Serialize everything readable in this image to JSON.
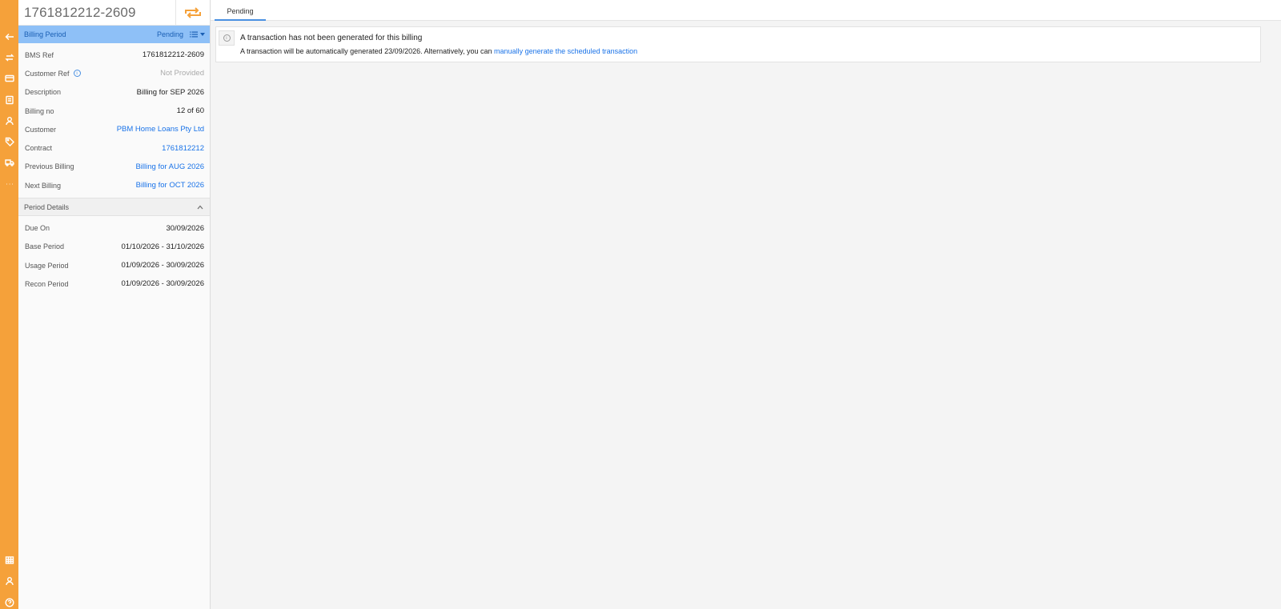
{
  "rail": {
    "top_icons": [
      "back-arrow-icon",
      "swap-icon",
      "card-icon",
      "document-icon",
      "user-icon",
      "tag-icon",
      "truck-icon",
      "more-icon"
    ],
    "bottom_icons": [
      "grid-icon",
      "account-icon",
      "help-icon"
    ]
  },
  "panel": {
    "title": "1761812212-2609",
    "period_bar": {
      "label": "Billing Period",
      "status": "Pending"
    },
    "fields": [
      {
        "label": "BMS Ref",
        "value": "1761812212-2609"
      },
      {
        "label": "Customer Ref",
        "value": "Not Provided"
      },
      {
        "label": "Description",
        "value": "Billing for SEP 2026"
      },
      {
        "label": "Billing no",
        "value": "12 of 60"
      },
      {
        "label": "Customer",
        "value": "PBM Home Loans Pty Ltd"
      },
      {
        "label": "Contract",
        "value": "1761812212"
      },
      {
        "label": "Previous Billing",
        "value": "Billing for AUG 2026"
      },
      {
        "label": "Next Billing",
        "value": "Billing for OCT 2026"
      }
    ],
    "period_details": {
      "label": "Period Details",
      "fields": [
        {
          "label": "Due On",
          "value": "30/09/2026"
        },
        {
          "label": "Base Period",
          "value": "01/10/2026 - 31/10/2026"
        },
        {
          "label": "Usage Period",
          "value": "01/09/2026 - 30/09/2026"
        },
        {
          "label": "Recon Period",
          "value": "01/09/2026 - 30/09/2026"
        }
      ]
    }
  },
  "main": {
    "tabs": [
      {
        "label": "Pending"
      }
    ],
    "notice": {
      "title": "A transaction has not been generated for this billing",
      "body": "A transaction will be automatically generated 23/09/2026. Alternatively, you can",
      "link": "manually generate the scheduled transaction"
    }
  },
  "colors": {
    "rail": "#f5a13a",
    "period_bar": "#8ec0f7",
    "link": "#1a73e8"
  }
}
